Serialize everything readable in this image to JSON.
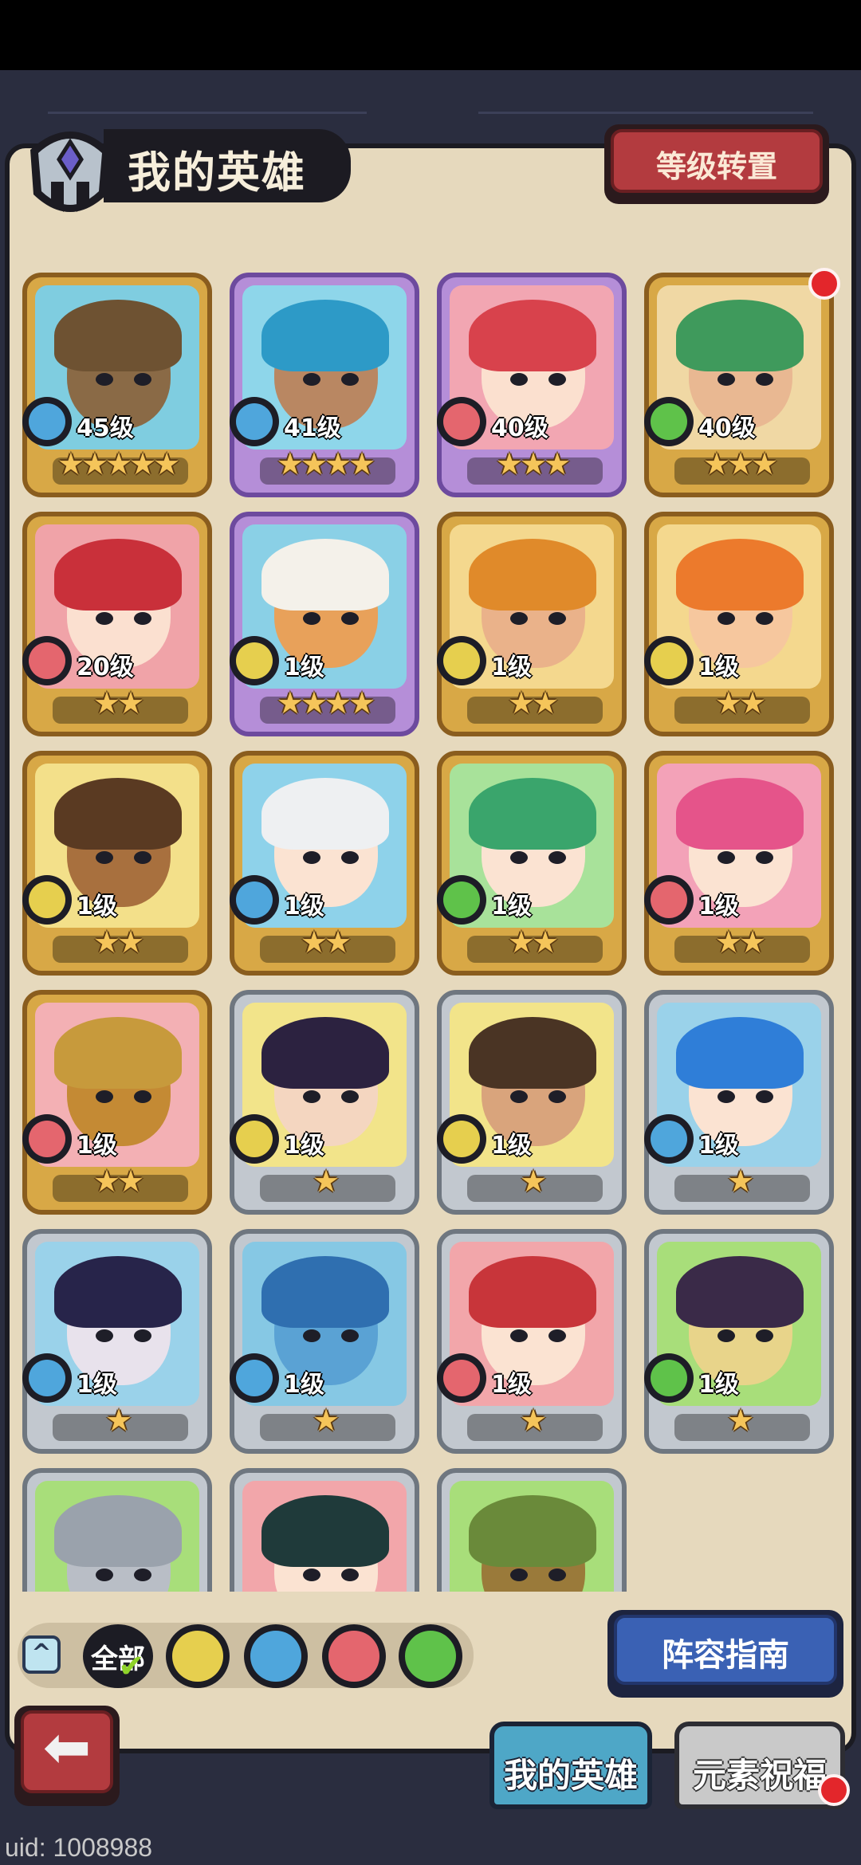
{
  "header": {
    "title": "我的英雄",
    "level_reset_button": "等级转置"
  },
  "heroes": [
    {
      "level": "45级",
      "stars": "★★★★★",
      "element": "water",
      "frame": "gold",
      "bg": "#7fcde0",
      "skin": "#8a6a46",
      "hair": "#6e5232"
    },
    {
      "level": "41级",
      "stars": "★★★★",
      "element": "water",
      "frame": "purple",
      "bg": "#8ed6ea",
      "skin": "#b98762",
      "hair": "#2d9ac7"
    },
    {
      "level": "40级",
      "stars": "★★★",
      "element": "fire",
      "frame": "purple",
      "bg": "#f2a6b2",
      "skin": "#fbe0cf",
      "hair": "#d8424c"
    },
    {
      "level": "40级",
      "stars": "★★★",
      "element": "wind",
      "frame": "gold",
      "bg": "#f0d8a4",
      "skin": "#e9b892",
      "hair": "#3f9a5c"
    },
    {
      "level": "20级",
      "stars": "★★",
      "element": "fire",
      "frame": "gold",
      "bg": "#f0a3a8",
      "skin": "#fbe0d0",
      "hair": "#c9303a"
    },
    {
      "level": "1级",
      "stars": "★★★★",
      "element": "earth",
      "frame": "purple",
      "bg": "#8ad0e6",
      "skin": "#e8a15a",
      "hair": "#f4f1ea"
    },
    {
      "level": "1级",
      "stars": "★★",
      "element": "earth",
      "frame": "gold",
      "bg": "#f4d88e",
      "skin": "#eab28a",
      "hair": "#e08a2a"
    },
    {
      "level": "1级",
      "stars": "★★",
      "element": "earth",
      "frame": "gold",
      "bg": "#f4d88e",
      "skin": "#f6c79e",
      "hair": "#ec7a2c"
    },
    {
      "level": "1级",
      "stars": "★★",
      "element": "earth",
      "frame": "gold",
      "bg": "#f3e08a",
      "skin": "#a8703e",
      "hair": "#5a3a22"
    },
    {
      "level": "1级",
      "stars": "★★",
      "element": "water",
      "frame": "gold",
      "bg": "#8ed2ea",
      "skin": "#fbe3d2",
      "hair": "#eef0f2"
    },
    {
      "level": "1级",
      "stars": "★★",
      "element": "wind",
      "frame": "gold",
      "bg": "#a8e29a",
      "skin": "#fbe3d2",
      "hair": "#3aa56c"
    },
    {
      "level": "1级",
      "stars": "★★",
      "element": "fire",
      "frame": "gold",
      "bg": "#f3a2b8",
      "skin": "#fbe3d2",
      "hair": "#e5548a"
    },
    {
      "level": "1级",
      "stars": "★★",
      "element": "fire",
      "frame": "gold",
      "bg": "#f3b0b4",
      "skin": "#c48a34",
      "hair": "#c79a3c"
    },
    {
      "level": "1级",
      "stars": "★",
      "element": "earth",
      "frame": "silver",
      "bg": "#f2e48a",
      "skin": "#f4d6c0",
      "hair": "#2c2240"
    },
    {
      "level": "1级",
      "stars": "★",
      "element": "earth",
      "frame": "silver",
      "bg": "#f2e48a",
      "skin": "#d9a47c",
      "hair": "#4a3424"
    },
    {
      "level": "1级",
      "stars": "★",
      "element": "water",
      "frame": "silver",
      "bg": "#9ad2ea",
      "skin": "#fbe3d2",
      "hair": "#2f7ed8"
    },
    {
      "level": "1级",
      "stars": "★",
      "element": "water",
      "frame": "silver",
      "bg": "#9ad2ea",
      "skin": "#e8e2ec",
      "hair": "#27244a"
    },
    {
      "level": "1级",
      "stars": "★",
      "element": "water",
      "frame": "silver",
      "bg": "#86c8e4",
      "skin": "#5aa2d4",
      "hair": "#2f6fb0"
    },
    {
      "level": "1级",
      "stars": "★",
      "element": "fire",
      "frame": "silver",
      "bg": "#f2a6aa",
      "skin": "#fbe3d2",
      "hair": "#c8353a"
    },
    {
      "level": "1级",
      "stars": "★",
      "element": "wind",
      "frame": "silver",
      "bg": "#a8de7a",
      "skin": "#e8d48a",
      "hair": "#3a2a48"
    },
    {
      "level": "",
      "stars": "",
      "element": "",
      "frame": "silver",
      "bg": "#a8de7a",
      "skin": "#b9bec6",
      "hair": "#9aa2ac"
    },
    {
      "level": "",
      "stars": "",
      "element": "",
      "frame": "silver",
      "bg": "#f2a6aa",
      "skin": "#fbe3d2",
      "hair": "#1f3a3a"
    },
    {
      "level": "",
      "stars": "",
      "element": "",
      "frame": "silver",
      "bg": "#a8de7a",
      "skin": "#9a7a3a",
      "hair": "#6a8a3a"
    }
  ],
  "filter": {
    "all_label": "全部",
    "elements": [
      "earth",
      "water",
      "fire",
      "wind"
    ]
  },
  "lineup_guide_button": "阵容指南",
  "tabs": {
    "my_heroes": "我的英雄",
    "element_blessing": "元素祝福"
  },
  "uid_text": "uid: 1008988",
  "element_colors": {
    "water": "#4fa6dc",
    "fire": "#e4666e",
    "wind": "#5fc24a",
    "earth": "#e6cf4e"
  }
}
